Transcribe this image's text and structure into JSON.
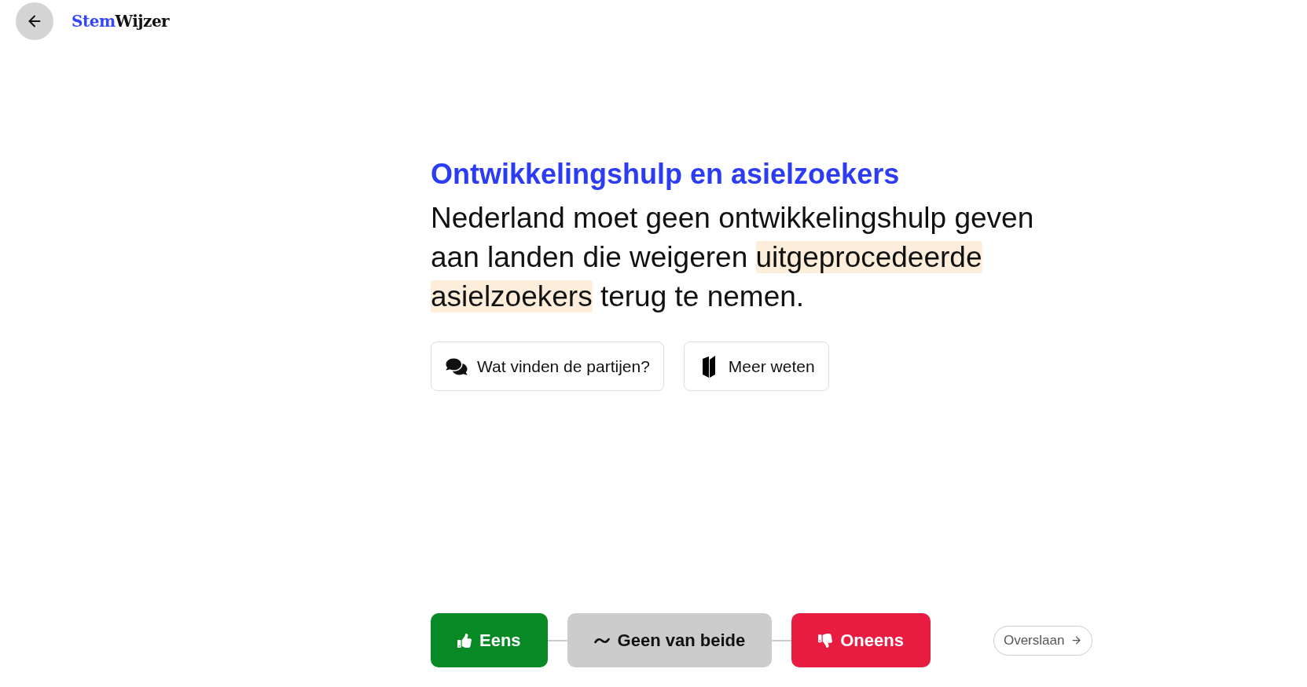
{
  "header": {
    "logo": {
      "accent_part": "Stem",
      "plain_part": "Wijzer"
    }
  },
  "statement": {
    "title": "Ontwikkelingshulp en asielzoekers",
    "text_parts": [
      {
        "text": "Nederland moet geen ontwikkelingshulp geven aan landen die weigeren ",
        "highlighted": false
      },
      {
        "text": "uitgeprocedeerde asielzoekers",
        "highlighted": true
      },
      {
        "text": " terug te nemen.",
        "highlighted": false
      }
    ]
  },
  "info_buttons": [
    {
      "kind": "parties",
      "label": "Wat vinden de partijen?"
    },
    {
      "kind": "more_info",
      "label": "Meer weten"
    }
  ],
  "answer_buttons": [
    {
      "kind": "agree",
      "label": "Eens"
    },
    {
      "kind": "neutral",
      "label": "Geen van beide"
    },
    {
      "kind": "disagree",
      "label": "Oneens"
    }
  ],
  "skip_button": {
    "label": "Overslaan"
  }
}
